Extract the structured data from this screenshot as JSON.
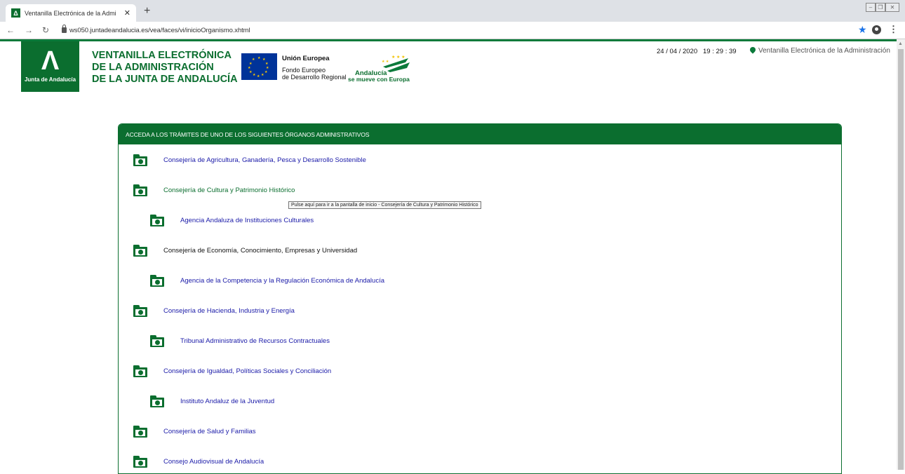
{
  "browser": {
    "tab_title": "Ventanilla Electrónica de la Admi",
    "tab_favicon": "Δ",
    "url": "ws050.juntadeandalucia.es/vea/faces/vi/inicioOrganismo.xhtml"
  },
  "header": {
    "logo_letter": "Λ",
    "logo_caption": "Junta de Andalucía",
    "title_lines": [
      "VENTANILLA ELECTRÓNICA",
      "DE LA ADMINISTRACIÓN",
      "DE LA JUNTA DE ANDALUCÍA"
    ],
    "eu_title": "Unión Europea",
    "eu_fund_lines": [
      "Fondo Europeo",
      "de Desarrollo Regional"
    ],
    "andalucia_line1": "Andalucía",
    "andalucia_line2": "se mueve con Europa",
    "datetime": "24 / 04 / 2020   19 : 29 : 39",
    "portal_link": "Ventanilla Electrónica de la Administración"
  },
  "panel": {
    "heading": "ACCEDA A LOS TRÁMITES DE UNO DE LOS SIGUIENTES ÓRGANOS ADMINISTRATIVOS",
    "items": [
      {
        "label": "Consejería de Agricultura, Ganadería, Pesca y Desarrollo Sostenible",
        "level": 0,
        "style": "link"
      },
      {
        "label": "Consejería de Cultura y Patrimonio Histórico",
        "level": 0,
        "style": "hover"
      },
      {
        "label": "Agencia Andaluza de Instituciones Culturales",
        "level": 1,
        "style": "link"
      },
      {
        "label": "Consejería de Economía, Conocimiento, Empresas y Universidad",
        "level": 0,
        "style": "plain"
      },
      {
        "label": "Agencia de la Competencia y la Regulación Económica de Andalucía",
        "level": 1,
        "style": "link"
      },
      {
        "label": "Consejería de Hacienda, Industria y Energía",
        "level": 0,
        "style": "link"
      },
      {
        "label": "Tribunal Administrativo de Recursos Contractuales",
        "level": 1,
        "style": "link"
      },
      {
        "label": "Consejería de Igualdad, Políticas Sociales y Conciliación",
        "level": 0,
        "style": "link"
      },
      {
        "label": "Instituto Andaluz de la Juventud",
        "level": 1,
        "style": "link"
      },
      {
        "label": "Consejería de Salud y Familias",
        "level": 0,
        "style": "link"
      },
      {
        "label": "Consejo Audiovisual de Andalucía",
        "level": 0,
        "style": "link"
      }
    ],
    "tooltip": "Pulse aquí para ir a la pantalla de inicio - Consejería de Cultura y Patrimonio Histórico"
  },
  "colors": {
    "brand_green": "#0b6e2f",
    "link_blue": "#1a1aa8",
    "eu_blue": "#003399",
    "eu_gold": "#ffcc00"
  },
  "icons": {
    "folder": "folder-globe-icon",
    "pin": "map-pin-icon",
    "star": "star-icon"
  }
}
